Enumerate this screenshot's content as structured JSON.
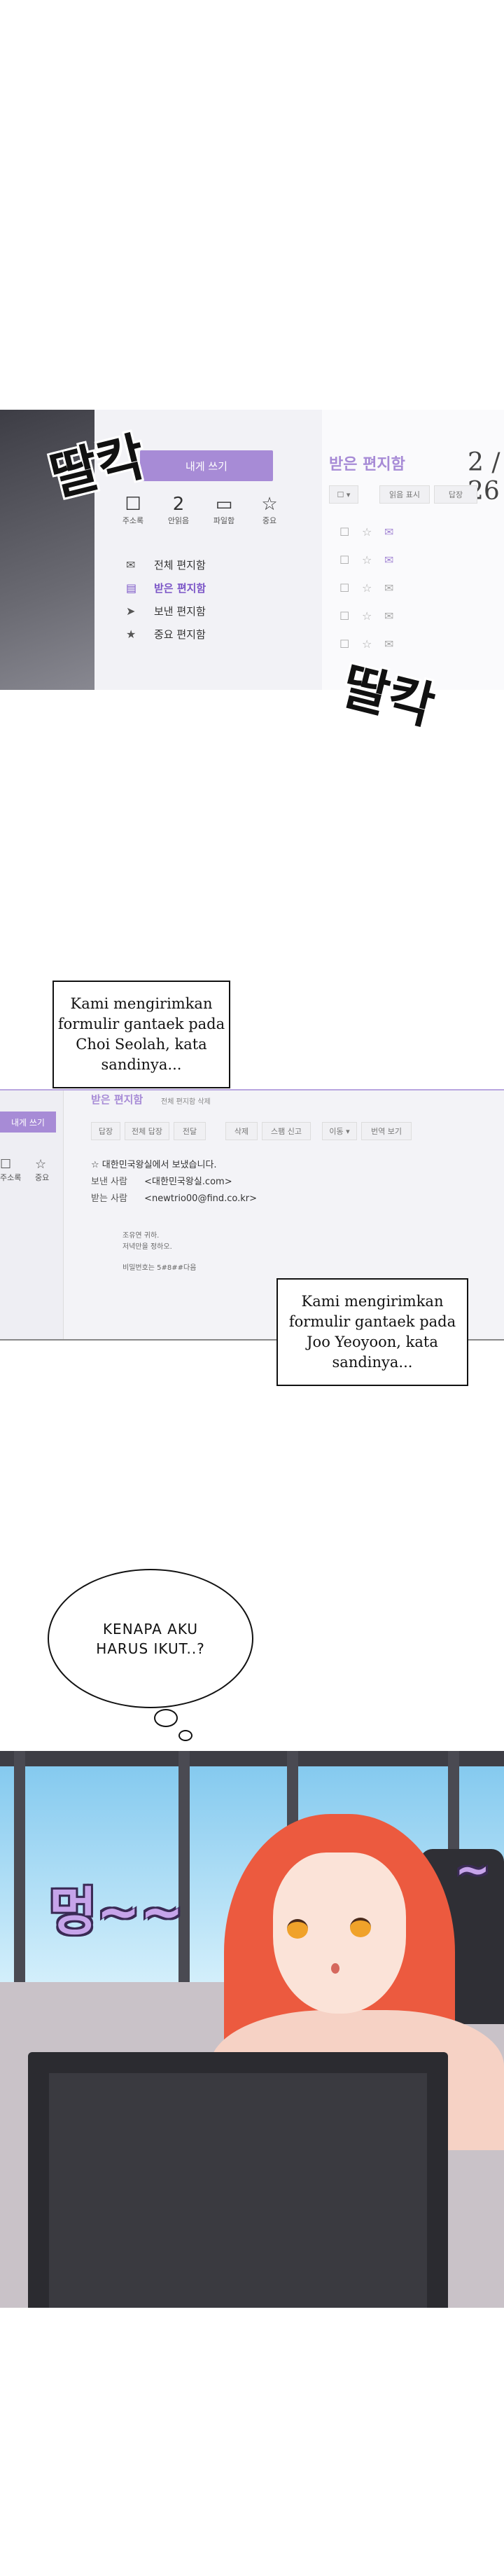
{
  "panel_email_list": {
    "compose_label": "내게 쓰기",
    "folder_title": "받은 편지함",
    "page_count": "2 / 26",
    "toolbar": [
      "읽음 표시",
      "답장"
    ],
    "icon_labels": [
      "주소록",
      "안읽음",
      "파일함",
      "중요"
    ],
    "unread_badge": "2",
    "folders": [
      "전체 편지함",
      "받은 편지함",
      "보낸 편지함",
      "중요 편지함"
    ],
    "sfx_top": "딸칵",
    "sfx_bottom": "딸칵"
  },
  "caption_1": {
    "text": "Kami mengirimkan formulir gantaek pada Choi Seolah, kata sandinya..."
  },
  "panel_email_open": {
    "compose_label": "내게 쓰기",
    "side_icons": [
      "주소록",
      "중요"
    ],
    "title": "받은 편지함",
    "subtitle": "전체 편지함 삭제",
    "toolbar": [
      "답장",
      "전체 답장",
      "전달",
      "삭제",
      "스팸 신고",
      "이동 ▾",
      "번역 보기"
    ],
    "notice": "대한민국왕실에서 보냈습니다.",
    "sender_label": "보낸 사람",
    "sender_value": "<대한민국왕실.com>",
    "receiver_label": "받는 사람",
    "receiver_value": "<newtrio00@find.co.kr>",
    "body_lines": [
      "조유연 귀하.",
      "저녁만을 정하오.",
      "비밀번호는 5#8##다음"
    ]
  },
  "caption_2": {
    "text": "Kami mengirimkan formulir gantaek pada Joo Yeoyoon, kata sandinya..."
  },
  "thought_bubble": {
    "text": "KENAPA AKU HARUS IKUT..?"
  },
  "panel_character": {
    "sfx_left": "멍~~",
    "sfx_right": "~"
  }
}
